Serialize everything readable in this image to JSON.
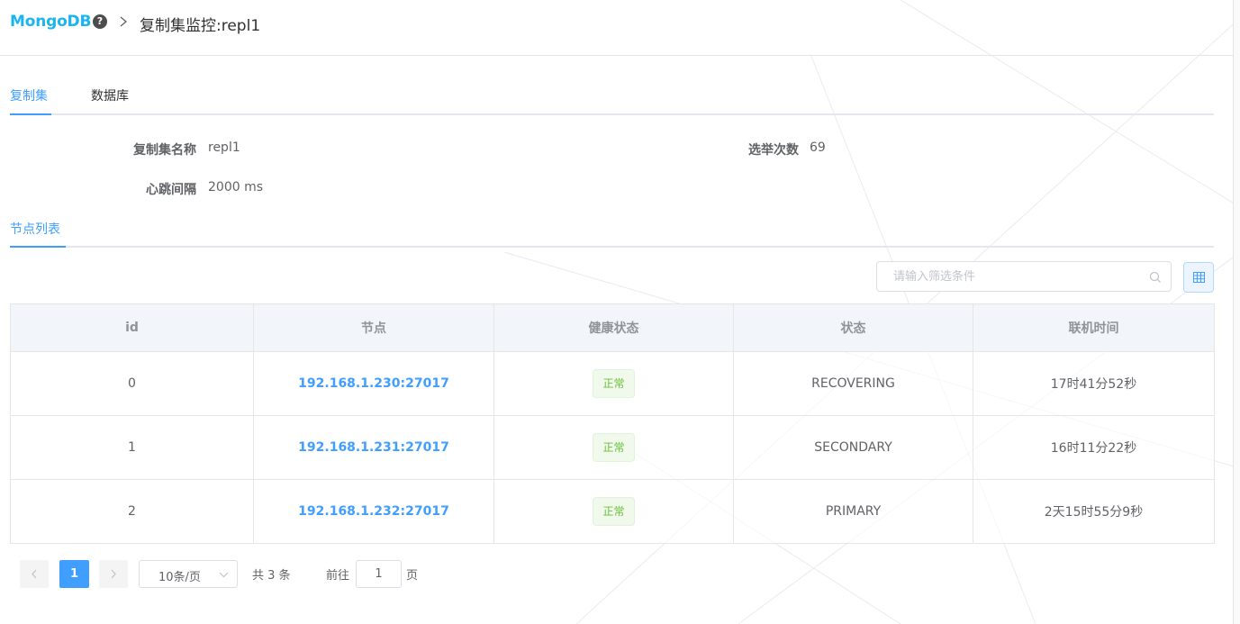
{
  "header": {
    "brand": "MongoDB",
    "help_glyph": "?",
    "title": "复制集监控:repl1"
  },
  "tabs": [
    {
      "label": "复制集",
      "active": true
    },
    {
      "label": "数据库",
      "active": false
    }
  ],
  "details": {
    "name_label": "复制集名称",
    "name_value": "repl1",
    "elections_label": "选举次数",
    "elections_value": "69",
    "heartbeat_label": "心跳间隔",
    "heartbeat_value": "2000 ms"
  },
  "subtabs": [
    {
      "label": "节点列表",
      "active": true
    }
  ],
  "search": {
    "placeholder": "请输入筛选条件"
  },
  "table": {
    "columns": [
      "id",
      "节点",
      "健康状态",
      "状态",
      "联机时间"
    ],
    "rows": [
      {
        "id": "0",
        "node": "192.168.1.230:27017",
        "health": "正常",
        "state": "RECOVERING",
        "uptime": "17时41分52秒"
      },
      {
        "id": "1",
        "node": "192.168.1.231:27017",
        "health": "正常",
        "state": "SECONDARY",
        "uptime": "16时11分22秒"
      },
      {
        "id": "2",
        "node": "192.168.1.232:27017",
        "health": "正常",
        "state": "PRIMARY",
        "uptime": "2天15时55分9秒"
      }
    ]
  },
  "pagination": {
    "current_page": "1",
    "page_size": "10条/页",
    "total": "共 3 条",
    "goto_label": "前往",
    "goto_value": "1",
    "page_suffix": "页"
  },
  "colors": {
    "brand": "#1ab4ef",
    "accent": "#409eff",
    "success": "#67c23a"
  }
}
